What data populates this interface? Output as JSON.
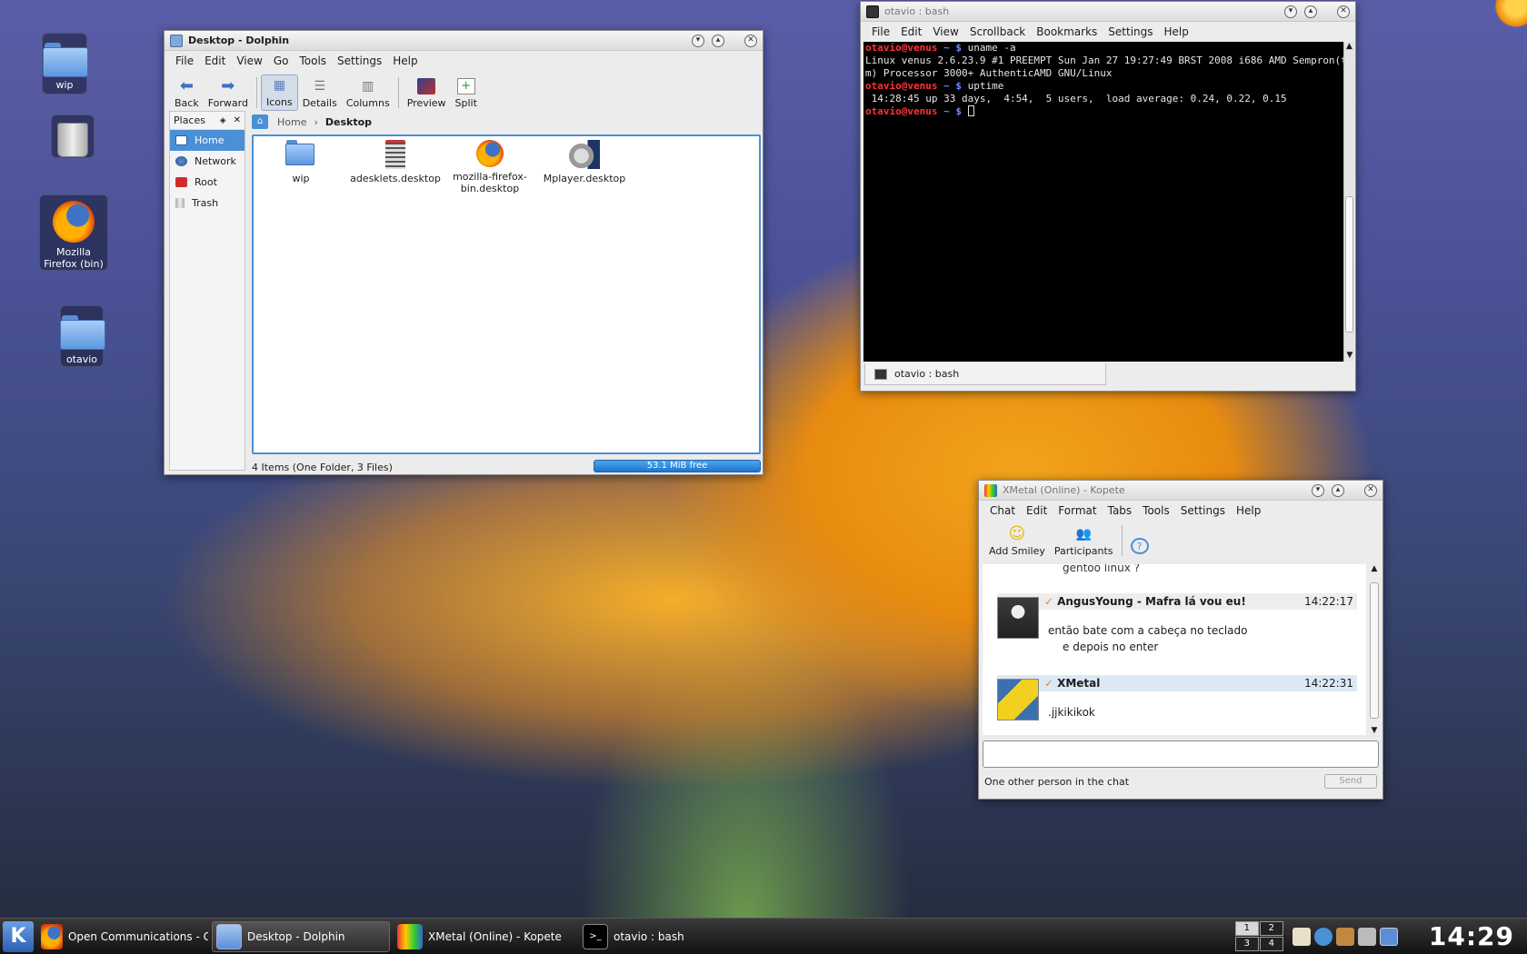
{
  "desktop": {
    "icons": [
      {
        "label": "wip",
        "icon": "folder-icon"
      },
      {
        "label": "",
        "icon": "trash-icon"
      },
      {
        "label": "Mozilla Firefox (bin)",
        "icon": "firefox-icon"
      },
      {
        "label": "otavio",
        "icon": "folder-icon"
      }
    ]
  },
  "dolphin": {
    "title": "Desktop - Dolphin",
    "menu": [
      "File",
      "Edit",
      "View",
      "Go",
      "Tools",
      "Settings",
      "Help"
    ],
    "toolbar": [
      "Back",
      "Forward",
      "Icons",
      "Details",
      "Columns",
      "Preview",
      "Split"
    ],
    "places": {
      "title": "Places",
      "items": [
        "Home",
        "Network",
        "Root",
        "Trash"
      ]
    },
    "breadcrumb": [
      "Home",
      "Desktop"
    ],
    "files": [
      {
        "name": "wip",
        "icon": "folder-icon"
      },
      {
        "name": "adesklets.desktop",
        "icon": "adesklets-icon"
      },
      {
        "name": "mozilla-firefox-bin.desktop",
        "icon": "firefox-icon"
      },
      {
        "name": "Mplayer.desktop",
        "icon": "mplayer-icon"
      }
    ],
    "status": "4 Items (One Folder, 3 Files)",
    "free_space": "53.1 MiB free"
  },
  "terminal": {
    "title": "otavio : bash",
    "menu": [
      "File",
      "Edit",
      "View",
      "Scrollback",
      "Bookmarks",
      "Settings",
      "Help"
    ],
    "prompt_user": "otavio@venus",
    "prompt_path": "~ $",
    "lines": [
      {
        "cmd": "uname -a"
      },
      {
        "out": "Linux venus 2.6.23.9 #1 PREEMPT Sun Jan 27 19:27:49 BRST 2008 i686 AMD Sempron(t"
      },
      {
        "out": "m) Processor 3000+ AuthenticAMD GNU/Linux"
      },
      {
        "cmd": "uptime"
      },
      {
        "out": " 14:28:45 up 33 days,  4:54,  5 users,  load average: 0.24, 0.22, 0.15"
      },
      {
        "cmd": ""
      }
    ],
    "tab_label": "otavio : bash"
  },
  "kopete": {
    "title": "XMetal (Online) - Kopete",
    "menu": [
      "Chat",
      "Edit",
      "Format",
      "Tabs",
      "Tools",
      "Settings",
      "Help"
    ],
    "toolbar": [
      "Add Smiley",
      "Participants"
    ],
    "partial_line": "gentoo linux ?",
    "messages": [
      {
        "from": "AngusYoung - Mafra lá vou eu!",
        "time": "14:22:17",
        "lines": [
          "então bate com a cabeça no teclado",
          "e depois no enter"
        ]
      },
      {
        "from": "XMetal",
        "time": "14:22:31",
        "lines": [
          ".jjkikikok"
        ]
      }
    ],
    "status": "One other person in the chat",
    "send_label": "Send"
  },
  "taskbar": {
    "kmenu": "K",
    "tasks": [
      {
        "label": "Open Communications - Goog",
        "icon": "firefox-icon"
      },
      {
        "label": "Desktop - Dolphin",
        "icon": "dolphin-icon"
      },
      {
        "label": "XMetal (Online) - Kopete",
        "icon": "kopete-icon"
      },
      {
        "label": "otavio : bash",
        "icon": "terminal-icon"
      }
    ],
    "pager": [
      "1",
      "2",
      "3",
      "4"
    ],
    "clock": "14:29"
  },
  "colors": {
    "selection": "#4a90d6",
    "prompt_user": "#ff3333",
    "prompt_path": "#6a8cff"
  }
}
